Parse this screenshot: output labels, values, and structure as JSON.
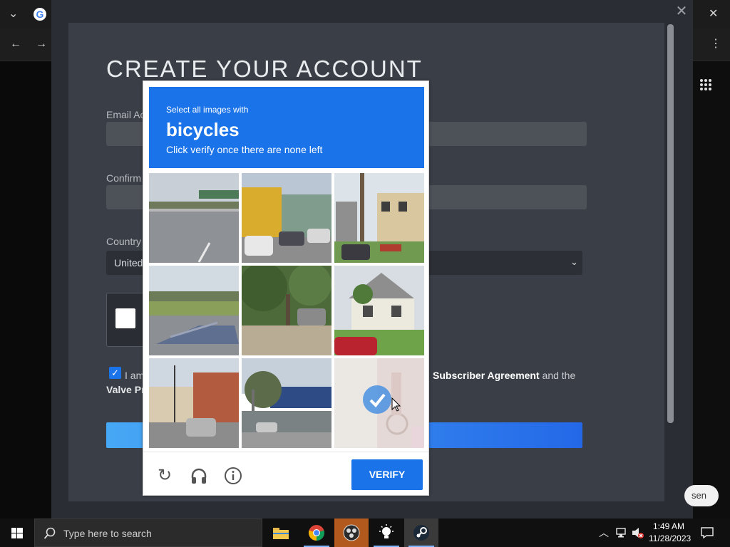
{
  "steam": {
    "title": "CREATE YOUR ACCOUNT",
    "email_label": "Email Ac",
    "confirm_label": "Confirm",
    "country_label": "Country",
    "country_value": "United",
    "agree_prefix": "I am",
    "agree_link": "Subscriber Agreement",
    "agree_tail": "and the",
    "agree_line2": "Valve Pr",
    "open_label": "sen"
  },
  "captcha": {
    "instruction_line1": "Select all images with",
    "target": "bicycles",
    "instruction_line2": "Click verify once there are none left",
    "verify_label": "VERIFY",
    "tiles": [
      {
        "id": "tile-1",
        "subject": "highway-overpass",
        "selected": false
      },
      {
        "id": "tile-2",
        "subject": "yellow-building-parking",
        "selected": false
      },
      {
        "id": "tile-3",
        "subject": "houses-tree",
        "selected": false
      },
      {
        "id": "tile-4",
        "subject": "car-trailer-field",
        "selected": false
      },
      {
        "id": "tile-5",
        "subject": "trees-driveway",
        "selected": false
      },
      {
        "id": "tile-6",
        "subject": "white-house-lawn",
        "selected": false
      },
      {
        "id": "tile-7",
        "subject": "street-intersection",
        "selected": false
      },
      {
        "id": "tile-8",
        "subject": "parking-lot-street",
        "selected": false
      },
      {
        "id": "tile-9",
        "subject": "bicycle-rider",
        "selected": true
      }
    ]
  },
  "taskbar": {
    "search_placeholder": "Type here to search",
    "clock_time": "1:49 AM",
    "clock_date": "11/28/2023"
  },
  "colors": {
    "captcha_blue": "#1a73e8",
    "steam_bg": "#3a3e46"
  }
}
